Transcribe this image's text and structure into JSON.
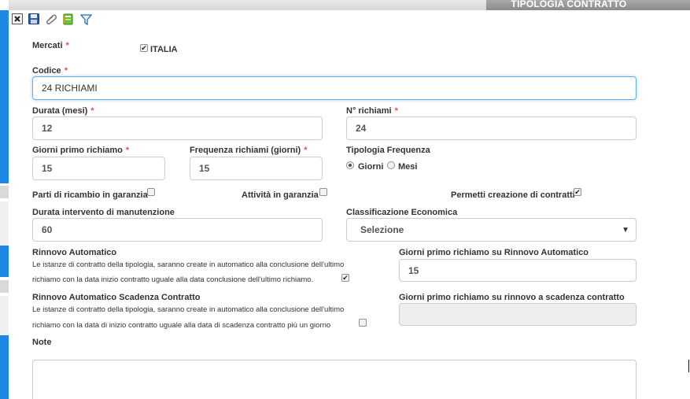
{
  "window": {
    "title": "TIPOLOGIA CONTRATTO"
  },
  "toolbar": {
    "icons": [
      "close-icon",
      "save-icon",
      "attach-icon",
      "notes-icon",
      "filter-icon"
    ]
  },
  "form": {
    "mercati": {
      "label": "Mercati",
      "required": "*",
      "option": "ITALIA",
      "checked": true
    },
    "codice": {
      "label": "Codice",
      "required": "*",
      "value": "24 RICHIAMI"
    },
    "durata": {
      "label": "Durata (mesi)",
      "required": "*",
      "value": "12"
    },
    "n_richiami": {
      "label": "N° richiami",
      "required": "*",
      "value": "24"
    },
    "giorni_primo": {
      "label": "Giorni primo richiamo",
      "required": "*",
      "value": "15"
    },
    "frequenza": {
      "label": "Frequenza richiami (giorni)",
      "required": "*",
      "value": "15"
    },
    "tipologia_freq": {
      "label": "Tipologia Frequenza",
      "options": [
        "Giorni",
        "Mesi"
      ],
      "selected": "Giorni"
    },
    "parti_ricambio": {
      "label": "Parti di ricambio in garanzia",
      "checked": false
    },
    "attivita_garanzia": {
      "label": "Attività in garanzia",
      "checked": false
    },
    "permetti_creazione": {
      "label": "Permetti creazione di contratti",
      "checked": true
    },
    "durata_intervento": {
      "label": "Durata intervento di manutenzione",
      "value": "60"
    },
    "classificazione": {
      "label": "Classificazione Economica",
      "value": "Selezione"
    },
    "rinnovo_auto": {
      "label": "Rinnovo Automatico",
      "desc1": "Le istanze di contratto della tipologia, saranno create in automatico alla conclusione dell'ultimo",
      "desc2": "richiamo con la data inizio contratto uguale alla data conclusione dell'ultimo richiamo.",
      "checked": true
    },
    "giorni_rinnovo": {
      "label": "Giorni primo richiamo su Rinnovo Automatico",
      "value": "15"
    },
    "rinnovo_scadenza": {
      "label": "Rinnovo Automatico Scadenza Contratto",
      "desc1": "Le istanze di contratto della tipologia, saranno create in automatico alla conclusione dell'ultimo",
      "desc2": "richiamo con la data di inizio contratto uguale alla data di scadenza contratto più un giorno",
      "checked": false
    },
    "giorni_scadenza": {
      "label": "Giorni primo richiamo su rinnovo a scadenza contratto",
      "value": ""
    },
    "note": {
      "label": "Note",
      "value": ""
    }
  },
  "colors": {
    "accent_strip": "#1e88e5",
    "focus_border": "#66afe9",
    "required": "#d9534f"
  }
}
